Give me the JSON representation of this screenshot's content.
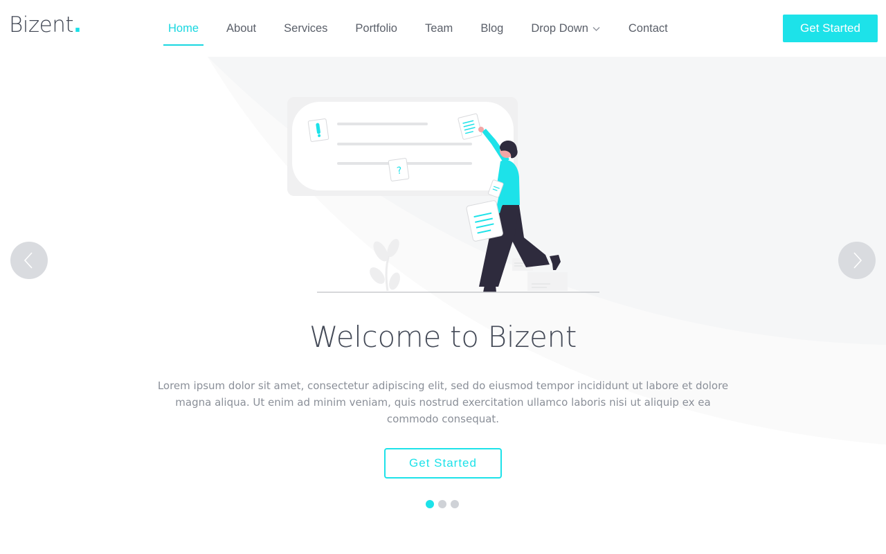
{
  "brand": {
    "name": "Bizent",
    "dot": ".",
    "accent_color": "#1de2e9"
  },
  "nav": {
    "items": [
      {
        "label": "Home",
        "active": true
      },
      {
        "label": "About"
      },
      {
        "label": "Services"
      },
      {
        "label": "Portfolio"
      },
      {
        "label": "Team"
      },
      {
        "label": "Blog"
      },
      {
        "label": "Drop Down",
        "has_dropdown": true,
        "icon": "chevron-down-icon"
      },
      {
        "label": "Contact"
      }
    ],
    "cta_label": "Get Started"
  },
  "hero": {
    "title": "Welcome to Bizent",
    "text": "Lorem ipsum dolor sit amet, consectetur adipiscing elit, sed do eiusmod tempor incididunt ut labore et dolore magna aliqua. Ut enim ad minim veniam, quis nostrud exercitation ullamco laboris nisi ut aliquip ex ea commodo consequat.",
    "button_label": "Get Started",
    "prev_icon": "chevron-left-icon",
    "next_icon": "chevron-right-icon"
  },
  "carousel": {
    "slide_count": 3,
    "active_index": 0
  }
}
